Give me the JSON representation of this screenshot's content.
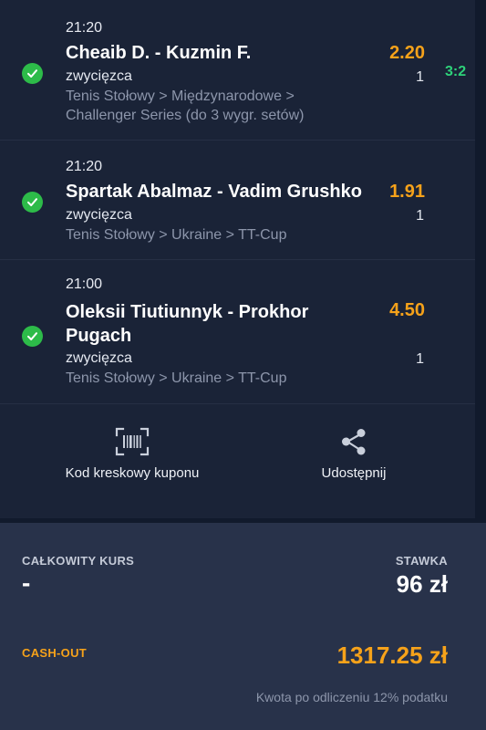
{
  "bets": [
    {
      "time": "21:20",
      "match": "Cheaib D. - Kuzmin F.",
      "odds": "2.20",
      "market": "zwycięzca",
      "pick": "1",
      "league_line1": "Tenis Stołowy > Międzynarodowe >",
      "league_line2": "Challenger Series (do 3 wygr. setów)",
      "score": "3:2",
      "status_icon": "check-circle-icon",
      "status_color": "#2dbb49"
    },
    {
      "time": "21:20",
      "match": "Spartak Abalmaz - Vadim Grushko",
      "odds": "1.91",
      "market": "zwycięzca",
      "pick": "1",
      "league_line1": "Tenis Stołowy > Ukraine > TT-Cup",
      "status_icon": "check-circle-icon",
      "status_color": "#2dbb49"
    },
    {
      "time": "21:00",
      "match_line1": "Oleksii Tiutiunnyk - Prokhor",
      "match_line2": "Pugach",
      "odds": "4.50",
      "market": "zwycięzca",
      "pick": "1",
      "league_line1": "Tenis Stołowy > Ukraine > TT-Cup",
      "status_icon": "check-circle-icon",
      "status_color": "#2dbb49"
    }
  ],
  "actions": {
    "barcode_label": "Kod kreskowy kuponu",
    "barcode_icon": "barcode-icon",
    "share_label": "Udostępnij",
    "share_icon": "share-icon"
  },
  "summary": {
    "total_odds_label": "CAŁKOWITY KURS",
    "total_odds_value": "-",
    "stake_label": "STAWKA",
    "stake_value": "96 zł",
    "cashout_label": "CASH-OUT",
    "cashout_value": "1317.25 zł",
    "tax_note": "Kwota po odliczeniu 12% podatku"
  },
  "colors": {
    "accent_orange": "#f6a21a",
    "win_green": "#2dbb49",
    "score_green": "#2ed27a",
    "card_bg": "#1a2337",
    "summary_bg": "#28324a"
  }
}
